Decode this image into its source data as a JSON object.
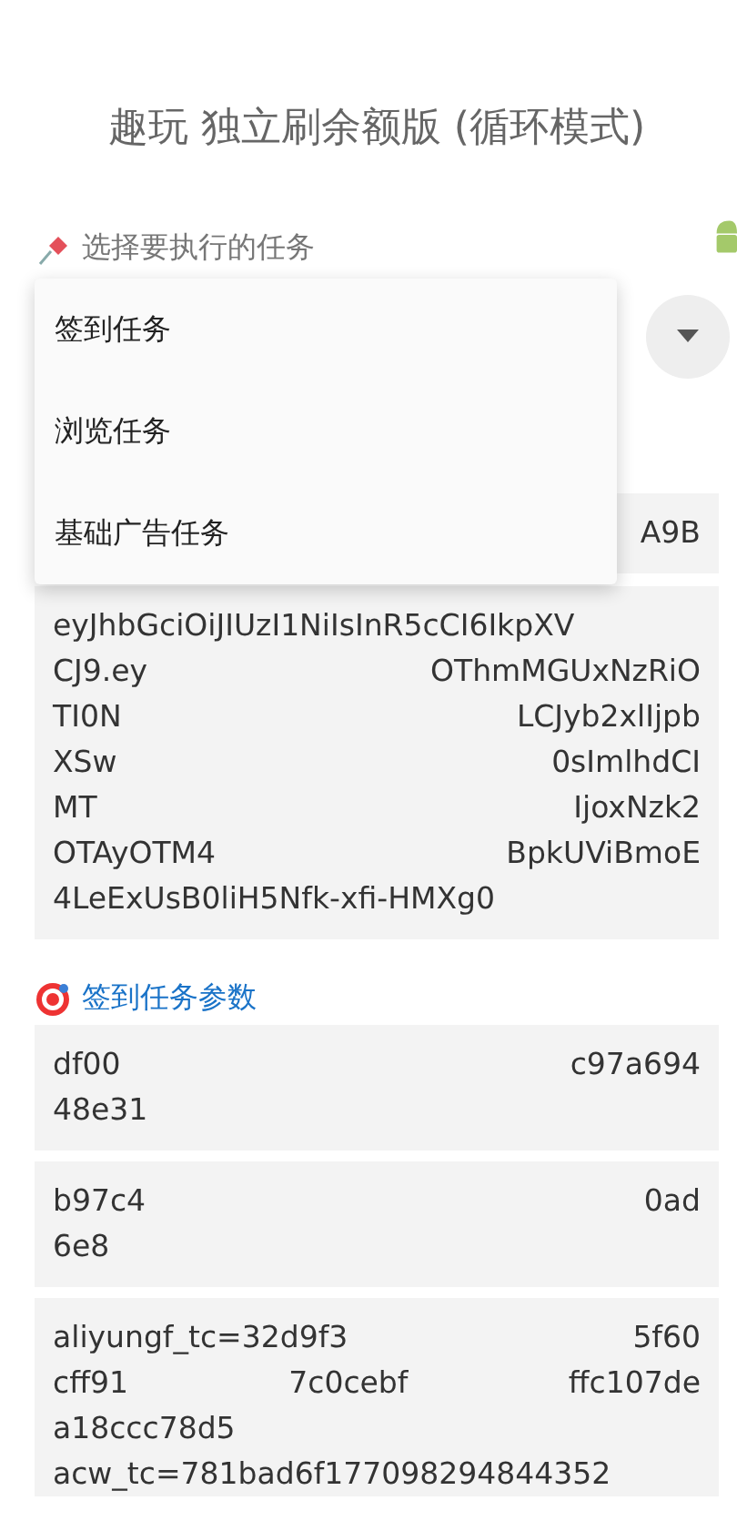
{
  "title": "趣玩 独立刷余额版 (循环模式)",
  "task_select": {
    "label": "选择要执行的任务",
    "menu": [
      {
        "label": "签到任务",
        "selected": false
      },
      {
        "label": "浏览任务",
        "selected": false
      },
      {
        "label": "基础广告任务",
        "selected": false
      }
    ]
  },
  "fields": [
    {
      "lines": [
        [
          "A9B"
        ]
      ]
    },
    {
      "lines": [
        [
          "eyJhbGciOiJIUzI1NiIsInR5cCI6IkpXV"
        ],
        [
          "CJ9.ey",
          "OThmMGUxNzRiO"
        ],
        [
          "TI0N",
          "LCJyb2xlIjpb"
        ],
        [
          "XSw",
          "0sImlhdCI"
        ],
        [
          "MT",
          "IjoxNzk2"
        ],
        [
          "OTAyOTM4",
          "BpkUViBmoE"
        ],
        [
          "4LeExUsB0liH5Nfk-xfi-HMXg0"
        ]
      ]
    }
  ],
  "section": {
    "label": "签到任务参数"
  },
  "param_fields": [
    {
      "lines": [
        [
          "df00",
          "c97a694"
        ],
        [
          "48e31"
        ]
      ]
    },
    {
      "lines": [
        [
          "b97c4",
          "0ad"
        ],
        [
          "6e8"
        ]
      ]
    },
    {
      "lines": [
        [
          "aliyungf_tc=32d9f3",
          "5f60"
        ],
        [
          "cff91",
          "7c0cebf",
          "ffc107de"
        ],
        [
          "a18ccc78d5"
        ],
        [
          "acw_tc=781bad6f177098294844352"
        ]
      ]
    }
  ]
}
